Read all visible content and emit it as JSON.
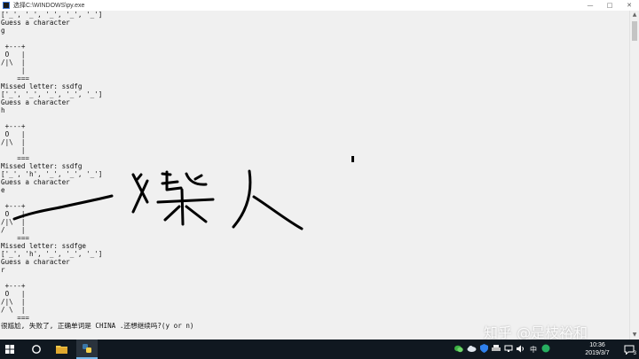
{
  "window": {
    "title": "选择C:\\WINDOWS\\py.exe",
    "buttons": {
      "minimize": "—",
      "maximize": "□",
      "close": "✕"
    }
  },
  "console": {
    "lines": [
      "['_', '_', '_', '_', '_']",
      "Guess a character",
      "g",
      "",
      " +---+",
      " O   |",
      "/|\\  |",
      "     |",
      "    ===",
      "Missed letter: ssdfg",
      "['_', '_', '_', '_', '_']",
      "Guess a character",
      "h",
      "",
      " +---+",
      " O   |",
      "/|\\  |",
      "     |",
      "    ===",
      "Missed letter: ssdfg",
      "['_', 'h', '_', '_', '_']",
      "Guess a character",
      "e",
      "",
      " +---+",
      " O   |",
      "/|\\  |",
      "/    |",
      "    ===",
      "Missed letter: ssdfge",
      "['_', 'h', '_', '_', '_']",
      "Guess a character",
      "r",
      "",
      " +---+",
      " O   |",
      "/|\\  |",
      "/ \\  |",
      "    ===",
      "很尴尬, 失败了, 正确单词是 CHINA .还想继续吗?(y or n)"
    ]
  },
  "scrollbar": {
    "up": "▲",
    "down": "▼"
  },
  "watermark": {
    "text": "知乎 @是枝裕和"
  },
  "taskbar": {
    "start_icon": "windows-logo-icon",
    "search_icon": "search-icon",
    "explorer_icon": "folder-icon",
    "python_icon": "python-icon",
    "ime": "中",
    "tray_icons": [
      "wechat-icon",
      "cloud-icon",
      "shield-icon",
      "printer-icon",
      "network-icon",
      "volume-icon"
    ],
    "time": "10:36",
    "date": "2019/3/7",
    "notification_count": "3"
  },
  "colors": {
    "console_bg": "#f0f0f0",
    "taskbar_bg": "#101820",
    "accent": "#76b9ed",
    "ink": "#000000"
  }
}
